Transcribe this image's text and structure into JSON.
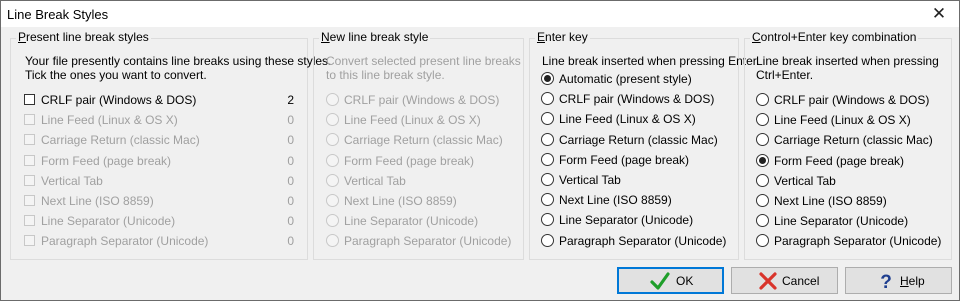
{
  "window": {
    "title": "Line Break Styles",
    "close_glyph": "✕"
  },
  "present": {
    "title_prefix": "P",
    "title_rest": "resent line break styles",
    "desc_line1": "Your file presently contains line breaks using these styles.",
    "desc_line2": "Tick the ones you want to convert.",
    "items": [
      {
        "label": "CRLF pair (Windows & DOS)",
        "count": "2",
        "enabled": true,
        "checked": false
      },
      {
        "label": "Line Feed (Linux & OS X)",
        "count": "0",
        "enabled": false,
        "checked": false
      },
      {
        "label": "Carriage Return (classic Mac)",
        "count": "0",
        "enabled": false,
        "checked": false
      },
      {
        "label": "Form Feed (page break)",
        "count": "0",
        "enabled": false,
        "checked": false
      },
      {
        "label": "Vertical Tab",
        "count": "0",
        "enabled": false,
        "checked": false
      },
      {
        "label": "Next Line (ISO 8859)",
        "count": "0",
        "enabled": false,
        "checked": false
      },
      {
        "label": "Line Separator (Unicode)",
        "count": "0",
        "enabled": false,
        "checked": false
      },
      {
        "label": "Paragraph Separator (Unicode)",
        "count": "0",
        "enabled": false,
        "checked": false
      }
    ]
  },
  "newstyle": {
    "title_prefix": "N",
    "title_rest": "ew line break style",
    "desc_line1": "Convert selected present line breaks",
    "desc_line2": "to this line break style.",
    "items": [
      "CRLF pair (Windows & DOS)",
      "Line Feed (Linux & OS X)",
      "Carriage Return (classic Mac)",
      "Form Feed (page break)",
      "Vertical Tab",
      "Next Line (ISO 8859)",
      "Line Separator (Unicode)",
      "Paragraph Separator (Unicode)"
    ]
  },
  "enter": {
    "title_prefix": "E",
    "title_rest": "nter key",
    "desc_line1": "Line break inserted when pressing Enter.",
    "selected_index": 0,
    "items": [
      "Automatic (present style)",
      "CRLF pair (Windows & DOS)",
      "Line Feed (Linux & OS X)",
      "Carriage Return (classic Mac)",
      "Form Feed (page break)",
      "Vertical Tab",
      "Next Line (ISO 8859)",
      "Line Separator (Unicode)",
      "Paragraph Separator (Unicode)"
    ]
  },
  "ctrlenter": {
    "title_prefix": "C",
    "title_rest": "ontrol+Enter key combination",
    "desc_line1": "Line break inserted when pressing",
    "desc_line2": "Ctrl+Enter.",
    "selected_index": 3,
    "items": [
      "CRLF pair (Windows & DOS)",
      "Line Feed (Linux & OS X)",
      "Carriage Return (classic Mac)",
      "Form Feed (page break)",
      "Vertical Tab",
      "Next Line (ISO 8859)",
      "Line Separator (Unicode)",
      "Paragraph Separator (Unicode)"
    ]
  },
  "buttons": {
    "ok": {
      "label": "OK",
      "icon": "checkmark-icon",
      "color": "#1e9e2a"
    },
    "cancel": {
      "label": "Cancel",
      "icon": "x-icon",
      "color": "#d9342b"
    },
    "help": {
      "label": "Help",
      "icon": "question-icon",
      "color": "#1f3f8f"
    }
  }
}
